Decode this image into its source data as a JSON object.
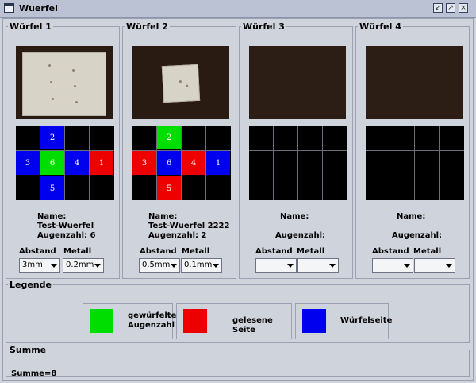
{
  "window": {
    "title": "Wuerfel"
  },
  "cubes": [
    {
      "title": "Würfel 1",
      "name_label": "Name:",
      "name_value": "Test-Wuerfel",
      "augen_label": "Augenzahl: 6",
      "abstand_label": "Abstand",
      "metall_label": "Metall",
      "abstand_value": "3mm",
      "metall_value": "0.2mm",
      "faces": {
        "top": "2",
        "left": "3",
        "center": "6",
        "right": "4",
        "far": "1",
        "bottom": "5"
      }
    },
    {
      "title": "Würfel 2",
      "name_label": "Name:",
      "name_value": "Test-Wuerfel 2222",
      "augen_label": "Augenzahl: 2",
      "abstand_label": "Abstand",
      "metall_label": "Metall",
      "abstand_value": "0.5mm",
      "metall_value": "0.1mm",
      "faces": {
        "top": "2",
        "left": "3",
        "center": "6",
        "right": "4",
        "far": "1",
        "bottom": "5"
      }
    },
    {
      "title": "Würfel 3",
      "name_label": "Name:",
      "name_value": "",
      "augen_label": "Augenzahl:",
      "abstand_label": "Abstand",
      "metall_label": "Metall",
      "abstand_value": "",
      "metall_value": ""
    },
    {
      "title": "Würfel 4",
      "name_label": "Name:",
      "name_value": "",
      "augen_label": "Augenzahl:",
      "abstand_label": "Abstand",
      "metall_label": "Metall",
      "abstand_value": "",
      "metall_value": ""
    }
  ],
  "legend": {
    "title": "Legende",
    "items": [
      {
        "label": "gewürfelte Augenzahl",
        "color": "#00dd00"
      },
      {
        "label": "gelesene Seite",
        "color": "#ee0000"
      },
      {
        "label": "Würfelseite",
        "color": "#0000ee"
      }
    ]
  },
  "summe": {
    "title": "Summe",
    "text": "Summe=8"
  },
  "colors": {
    "rolled": "#00dd00",
    "read": "#ee0000",
    "side": "#0000ee",
    "empty": "#000000",
    "gridline": "#6a6f7a"
  },
  "icons": [
    "window-icon",
    "minimize-icon",
    "maximize-icon",
    "close-icon",
    "dropdown-arrow-icon"
  ]
}
